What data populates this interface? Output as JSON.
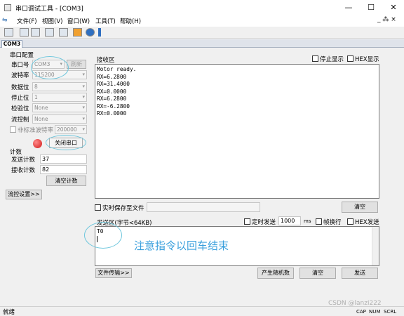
{
  "window": {
    "title": "串口调试工具 - [COM3]",
    "min": "—",
    "max": "☐",
    "close": "✕"
  },
  "menu": {
    "items": [
      "文件(F)",
      "视图(V)",
      "窗口(W)",
      "工具(T)",
      "帮助(H)"
    ],
    "mdi_controls": "_ ⁂ ×"
  },
  "tab": {
    "label": "COM3"
  },
  "serial_config": {
    "group_title": "串口配置",
    "port_label": "串口号",
    "port_value": "COM3",
    "refresh": "刷新",
    "baud_label": "波特率",
    "baud_value": "115200",
    "databits_label": "数据位",
    "databits_value": "8",
    "stopbits_label": "停止位",
    "stopbits_value": "1",
    "parity_label": "检验位",
    "parity_value": "None",
    "flow_label": "流控制",
    "flow_value": "None",
    "nonstd_label": "非标准波特率",
    "nonstd_value": "200000",
    "close_port": "关闭串口"
  },
  "counter": {
    "group_title": "计数",
    "sent_label": "发送计数",
    "sent_value": "37",
    "recv_label": "接收计数",
    "recv_value": "82",
    "clear": "清空计数"
  },
  "flow_settings": "流控设置>>",
  "receive": {
    "title": "接收区",
    "stop_display": "停止显示",
    "hex_display": "HEX显示",
    "lines": [
      "Motor ready.",
      "RX=6.2800",
      "RX=31.4000",
      "RX=0.0000",
      "RX=6.2800",
      "RX=-6.2800",
      "RX=0.0000"
    ],
    "save_realtime": "实时保存至文件",
    "clear": "清空"
  },
  "send": {
    "title": "发送区(字节<64KB)",
    "timed": "定时发送",
    "interval": "1000",
    "ms": "ms",
    "newline": "帧换行",
    "hex_send": "HEX发送",
    "text": "T0",
    "annotation": "注意指令以回车结束",
    "file_transfer": "文件传输>>",
    "random": "产生随机数",
    "clear": "清空",
    "send": "发送"
  },
  "status": {
    "left": "就绪",
    "caps": "CAP",
    "num": "NUM",
    "scrl": "SCRL",
    "watermark": "CSDN @lanzi222"
  },
  "colors": {
    "annotation": "#3ba0dd",
    "circle": "#6fc7dd",
    "indicator": "#e02020"
  }
}
